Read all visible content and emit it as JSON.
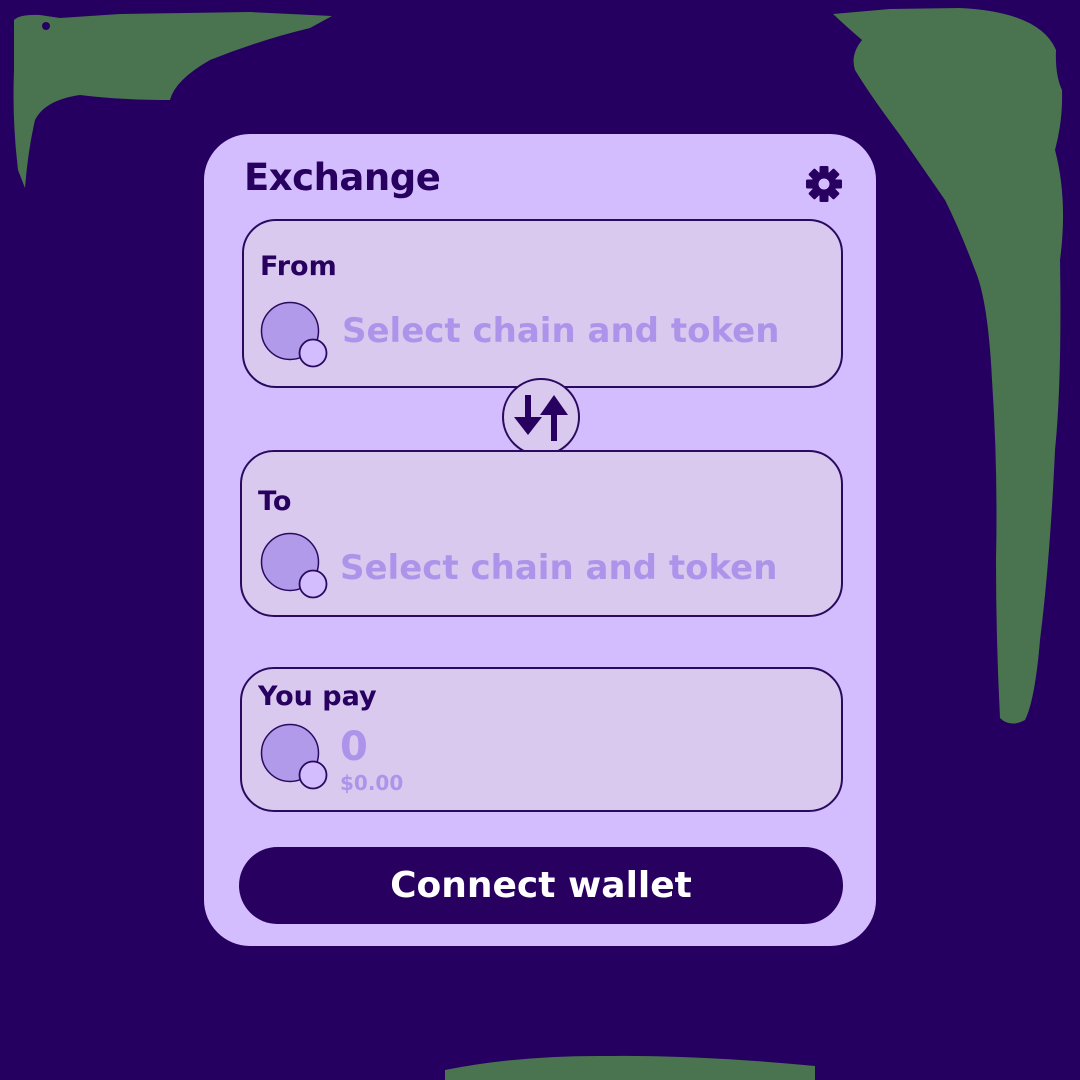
{
  "colors": {
    "background": "#260060",
    "decor_green": "#4a7350",
    "card": "#d3bdff",
    "panel": "#d9c9ef",
    "dark": "#28005f",
    "muted_text": "#ad94ea",
    "token_placeholder": "#b29aeb"
  },
  "widget": {
    "title": "Exchange",
    "settings_icon": "gear-icon"
  },
  "from": {
    "label": "From",
    "placeholder": "Select chain and token",
    "icon": "token-placeholder-icon"
  },
  "swap": {
    "icon": "swap-arrows-icon"
  },
  "to": {
    "label": "To",
    "placeholder": "Select chain and token",
    "icon": "token-placeholder-icon"
  },
  "pay": {
    "label": "You pay",
    "amount": "0",
    "fiat_value": "$0.00",
    "icon": "token-placeholder-icon"
  },
  "actions": {
    "connect_label": "Connect wallet"
  }
}
